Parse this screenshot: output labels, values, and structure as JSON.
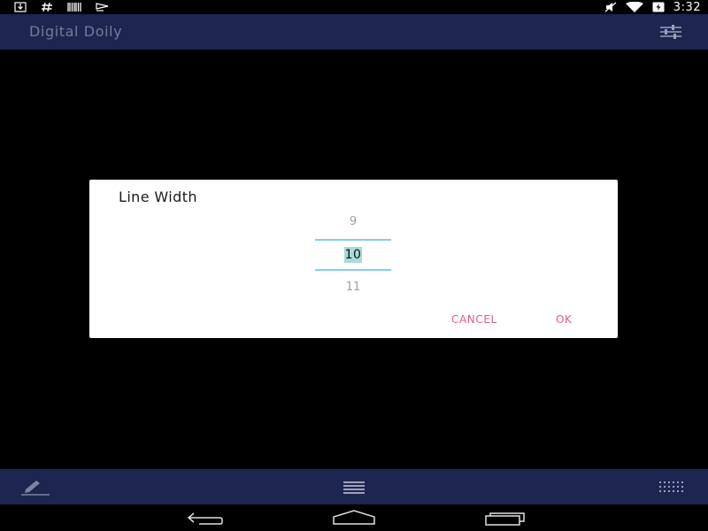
{
  "status_bar": {
    "time": "3:32",
    "left_icons": [
      "download-icon",
      "hash-icon",
      "barcode-icon",
      "sync-icon"
    ],
    "right_icons": [
      "mute-icon",
      "wifi-icon",
      "battery-charging-icon"
    ]
  },
  "app_bar": {
    "title": "Digital Doily",
    "menu_icon": "sliders-icon"
  },
  "dialog": {
    "title": "Line Width",
    "picker": {
      "previous": "9",
      "current": "10",
      "next": "11"
    },
    "cancel_label": "CANCEL",
    "ok_label": "OK"
  },
  "bottom_toolbar": {
    "icons": [
      "pencil-icon",
      "menu-lines-icon",
      "grid-dots-icon"
    ]
  },
  "nav_bar": {
    "icons": [
      "back-icon",
      "home-icon",
      "recents-icon"
    ]
  },
  "colors": {
    "app_bar_bg": "#1c2650",
    "title_text": "#737b98",
    "accent": "#e05a8c",
    "picker_divider": "#80d0e6",
    "picker_highlight": "#a6dcd6"
  }
}
